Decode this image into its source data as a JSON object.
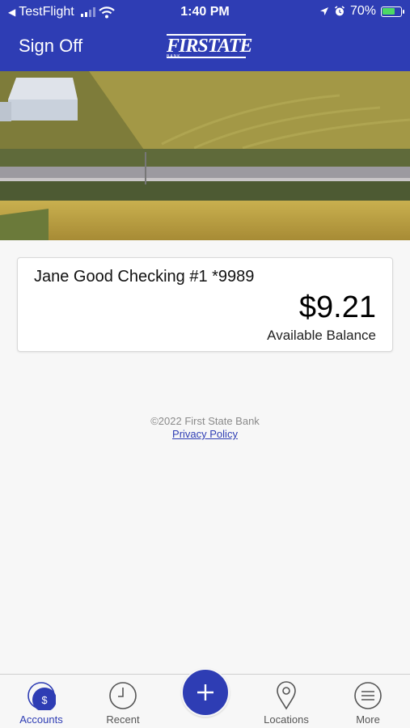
{
  "status_bar": {
    "back_app": "TestFlight",
    "time": "1:40 PM",
    "battery_percent": "70%",
    "battery_level": 0.7,
    "icons": [
      "back-arrow-icon",
      "signal-icon",
      "wifi-icon",
      "location-arrow-icon",
      "alarm-icon",
      "battery-charging-icon"
    ]
  },
  "header": {
    "sign_off_label": "Sign Off",
    "logo_text": "FIRSTATE",
    "logo_subtext": "BANK"
  },
  "account": {
    "name": "Jane Good Checking #1 *9989",
    "balance": "$9.21",
    "balance_label": "Available Balance"
  },
  "footer": {
    "copyright": "©2022 First State Bank",
    "privacy_link": "Privacy Policy"
  },
  "tabs": [
    {
      "label": "Accounts",
      "icon": "accounts-dollar-icon",
      "active": true
    },
    {
      "label": "Recent",
      "icon": "clock-icon",
      "active": false
    },
    {
      "label": "Locations",
      "icon": "map-pin-icon",
      "active": false
    },
    {
      "label": "More",
      "icon": "menu-icon",
      "active": false
    }
  ],
  "fab_icon": "plus-icon",
  "colors": {
    "brand": "#2e3db4",
    "background": "#f7f7f7",
    "battery_green": "#4cd964"
  }
}
